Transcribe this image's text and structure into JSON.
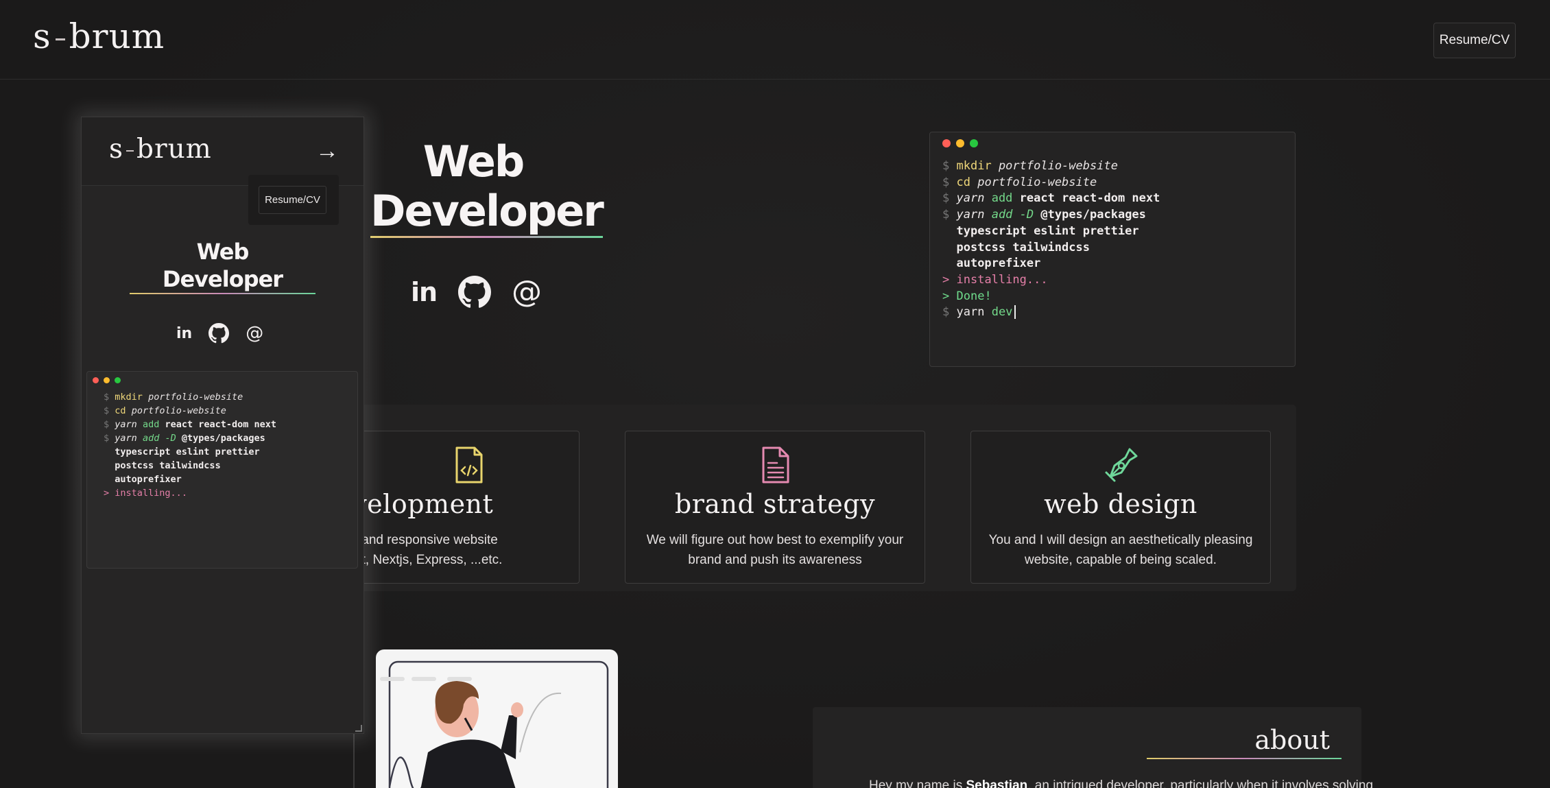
{
  "nav": {
    "logo_left": "s",
    "logo_right": "brum",
    "resume_label": "Resume/CV"
  },
  "hero": {
    "title_line1": "Web",
    "title_line2": "Developer"
  },
  "socials": {
    "linkedin": "in",
    "email": "@"
  },
  "terminal": {
    "lines": [
      {
        "prompt": "$",
        "cmd": "mkdir",
        "arg": "portfolio-website"
      },
      {
        "prompt": "$",
        "cmd": "cd",
        "arg": "portfolio-website"
      },
      {
        "prompt": "$",
        "cmd": "yarn",
        "sub": "add",
        "arg": "react react-dom next"
      },
      {
        "prompt": "$",
        "cmd": "yarn",
        "sub": "add -D",
        "arg": "@types/packages"
      },
      {
        "cont": "typescript eslint prettier"
      },
      {
        "cont": "postcss tailwindcss"
      },
      {
        "cont": "autoprefixer"
      },
      {
        "out_prompt": ">",
        "out": "installing..."
      },
      {
        "out_prompt": ">",
        "out": "Done!"
      },
      {
        "prompt": "$",
        "cmd": "yarn",
        "sub": "dev"
      }
    ]
  },
  "services": [
    {
      "title": "b development",
      "desc_line1": "o an scalable and responsive website",
      "desc_line2": "uch as React, Nextjs, Express, ...etc.",
      "icon": "code-file-icon",
      "color": "#e8d46c"
    },
    {
      "title": "brand strategy",
      "desc_line1": "We will figure out how best to exemplify your",
      "desc_line2": "brand and push its awareness",
      "icon": "document-icon",
      "color": "#e58ab0"
    },
    {
      "title": "web design",
      "desc_line1": "You and I will design an aesthetically pleasing",
      "desc_line2": "website, capable of being scaled.",
      "icon": "pen-nib-icon",
      "color": "#6fd79a"
    }
  ],
  "about": {
    "heading": "about",
    "text_pre": "Hey my name is ",
    "text_name": "Sebastian",
    "text_post": ", an intrigued developer, particularly when it involves solving"
  },
  "mobile": {
    "logo_left": "s",
    "logo_right": "brum",
    "arrow": "→",
    "resume_label": "Resume/CV",
    "title_line1": "Web",
    "title_line2": "Developer",
    "terminal_visible_lines": 8
  },
  "colors": {
    "accent_yellow": "#e8d46c",
    "accent_pink": "#e58ab0",
    "accent_green": "#6fd79a",
    "background": "#1d1c1c"
  }
}
